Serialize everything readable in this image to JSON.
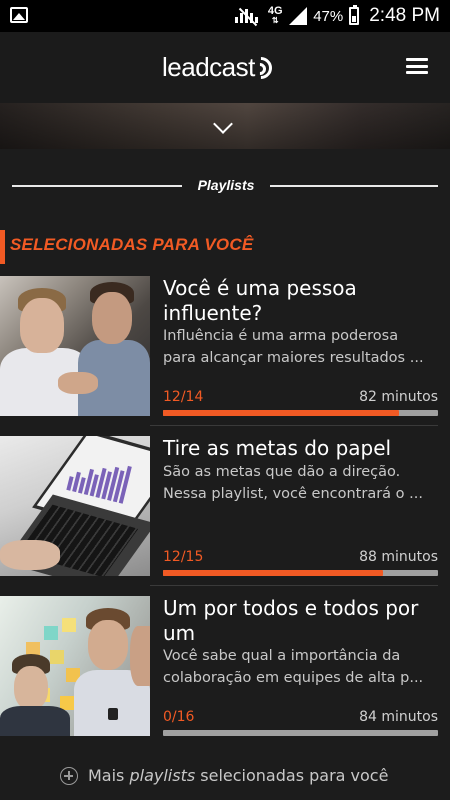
{
  "status_bar": {
    "image_icon": "image-icon",
    "mute_icon": "vibrate-mute-icon",
    "network": "4G",
    "signal_icon": "signal-icon",
    "battery_percent": "47%",
    "battery_icon": "battery-icon",
    "time": "2:48 PM"
  },
  "app_bar": {
    "logo_text": "leadcast",
    "logo_icon": "broadcast-waves-icon",
    "menu_icon": "hamburger-menu-icon"
  },
  "banner": {
    "expand_icon": "chevron-down-icon"
  },
  "section": {
    "label": "Playlists"
  },
  "selected": {
    "heading": "SELECIONADAS PARA VOCÊ",
    "accent_color": "#f15a24"
  },
  "playlists": [
    {
      "title_lines": [
        "Você é uma pessoa",
        "influente?"
      ],
      "desc_lines": [
        "Influência é uma arma poderosa",
        "para alcançar maiores resultados ..."
      ],
      "count": "12/14",
      "duration": "82 minutos",
      "progress": 0.857
    },
    {
      "title_lines": [
        "Tire as metas do papel"
      ],
      "desc_lines": [
        "São as metas que dão a direção.",
        "Nessa playlist, você encontrará o ..."
      ],
      "count": "12/15",
      "duration": "88 minutos",
      "progress": 0.8
    },
    {
      "title_lines": [
        "Um por todos e todos por",
        "um"
      ],
      "desc_lines": [
        "Você sabe qual a importância da",
        "colaboração em equipes de alta p..."
      ],
      "count": "0/16",
      "duration": "84 minutos",
      "progress": 0.0
    }
  ],
  "more": {
    "icon": "plus-circle-icon",
    "prefix": "Mais ",
    "emphasis": "playlists",
    "suffix": " selecionadas para você"
  }
}
